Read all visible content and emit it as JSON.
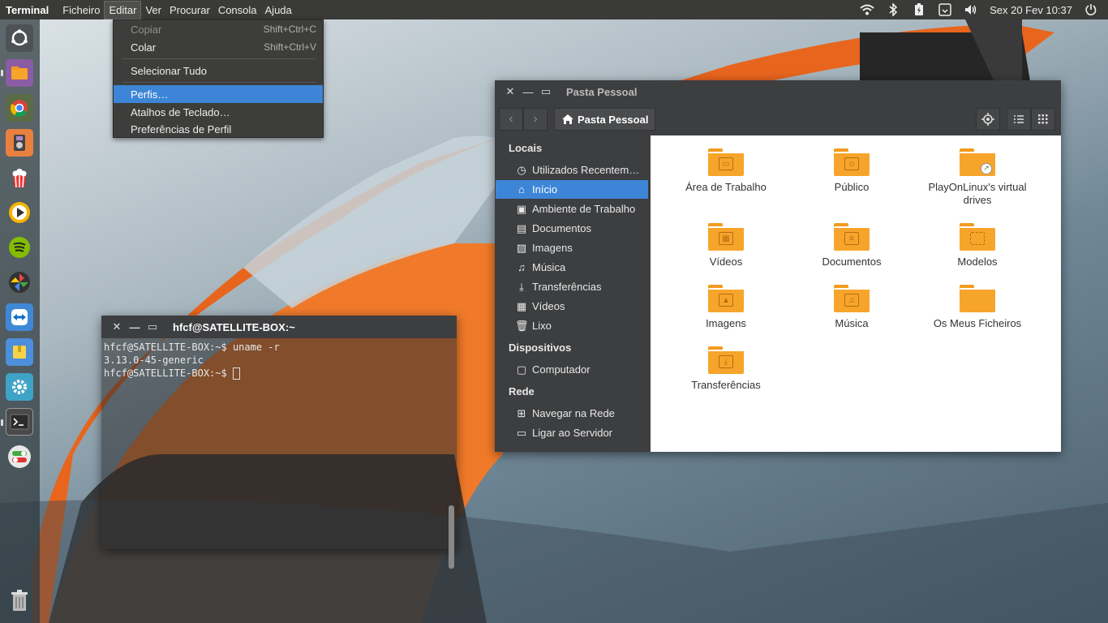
{
  "top_panel": {
    "app_name": "Terminal",
    "menus": [
      "Ficheiro",
      "Editar",
      "Ver",
      "Procurar",
      "Consola",
      "Ajuda"
    ],
    "clock": "Sex 20 Fev 10:37",
    "indicators": [
      "wifi-icon",
      "bluetooth-icon",
      "battery-icon",
      "dropbox-icon",
      "volume-icon",
      "power-icon"
    ]
  },
  "edit_menu": {
    "items": [
      {
        "label": "Copiar",
        "shortcut": "Shift+Ctrl+C"
      },
      {
        "label": "Colar",
        "shortcut": "Shift+Ctrl+V"
      },
      {
        "label": "Selecionar Tudo",
        "shortcut": ""
      },
      {
        "label": "Perfis…",
        "shortcut": ""
      },
      {
        "label": "Atalhos de Teclado…",
        "shortcut": ""
      },
      {
        "label": "Preferências de Perfil",
        "shortcut": ""
      }
    ]
  },
  "launcher": {
    "items": [
      "ubuntu-dash-icon",
      "files-icon",
      "chrome-icon",
      "music-player-icon",
      "popcorn-icon",
      "media-player-icon",
      "spotify-icon",
      "pinwheel-icon",
      "teamviewer-icon",
      "archive-icon",
      "settings-icon",
      "terminal-icon",
      "toggle-icon",
      "trash-icon"
    ]
  },
  "file_manager": {
    "title": "Pasta Pessoal",
    "path_label": "Pasta Pessoal",
    "sidebar": {
      "locais_heading": "Locais",
      "dispositivos_heading": "Dispositivos",
      "rede_heading": "Rede",
      "items": [
        "Utilizados Recentem…",
        "Início",
        "Ambiente de Trabalho",
        "Documentos",
        "Imagens",
        "Música",
        "Transferências",
        "Vídeos",
        "Lixo",
        "Computador",
        "Navegar na Rede",
        "Ligar ao Servidor"
      ]
    },
    "folders": [
      "Área de Trabalho",
      "Público",
      "PlayOnLinux's virtual drives",
      "Vídeos",
      "Documentos",
      "Modelos",
      "Imagens",
      "Música",
      "Os Meus Ficheiros",
      "Transferências"
    ]
  },
  "terminal": {
    "title": "hfcf@SATELLITE-BOX:~",
    "lines": [
      "hfcf@SATELLITE-BOX:~$ uname -r",
      "3.13.0-45-generic",
      "hfcf@SATELLITE-BOX:~$ "
    ]
  }
}
